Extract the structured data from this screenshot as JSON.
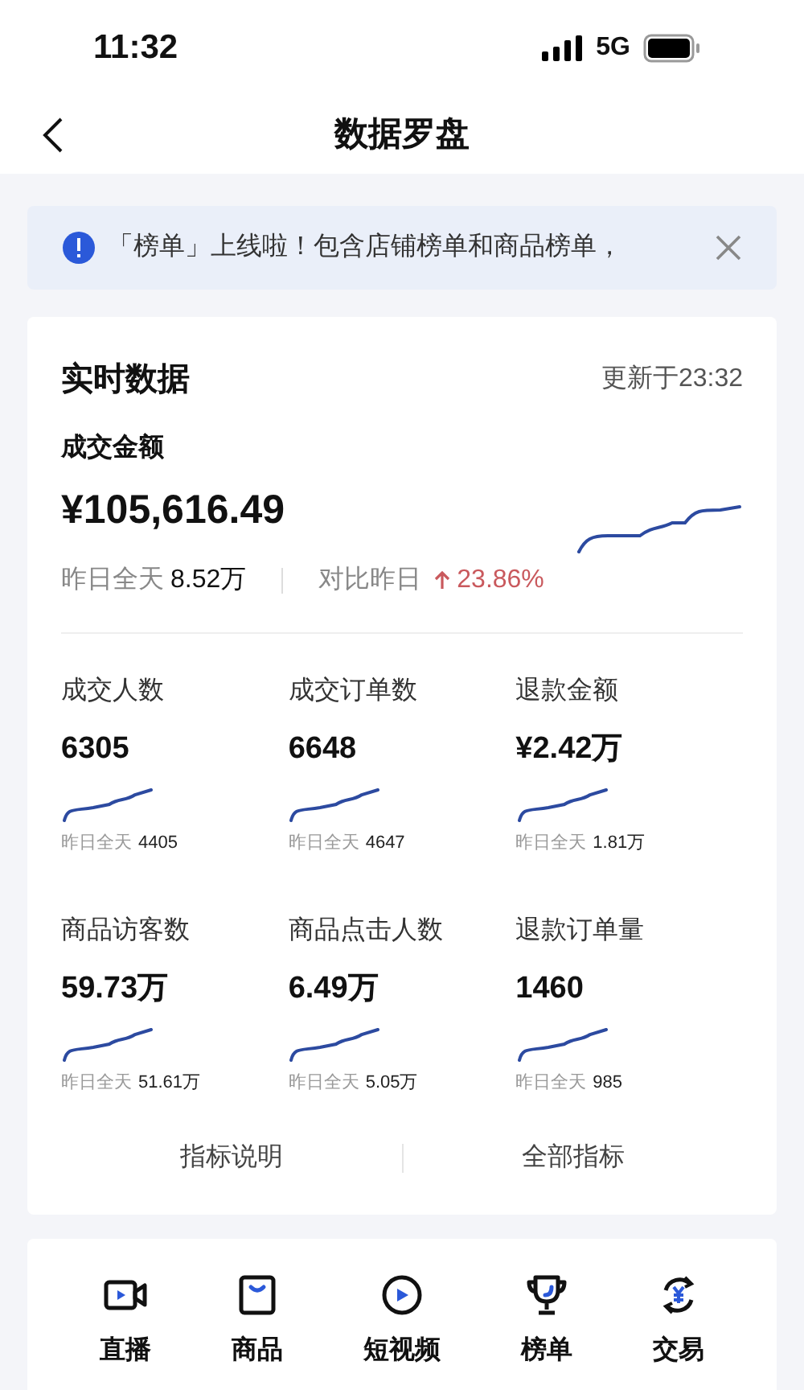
{
  "status_bar": {
    "time": "11:32",
    "network": "5G"
  },
  "header": {
    "title": "数据罗盘"
  },
  "notice": {
    "text": "「榜单」上线啦！包含店铺榜单和商品榜单，"
  },
  "realtime": {
    "title": "实时数据",
    "updated": "更新于23:32",
    "main": {
      "label": "成交金额",
      "value": "¥105,616.49",
      "yesterday_label": "昨日全天",
      "yesterday_value": "8.52万",
      "compare_label": "对比昨日",
      "change": "23.86%",
      "rising": true
    },
    "metrics": [
      {
        "label": "成交人数",
        "value": "6305",
        "yesterday_label": "昨日全天",
        "yesterday_value": "4405"
      },
      {
        "label": "成交订单数",
        "value": "6648",
        "yesterday_label": "昨日全天",
        "yesterday_value": "4647"
      },
      {
        "label": "退款金额",
        "value": "¥2.42万",
        "yesterday_label": "昨日全天",
        "yesterday_value": "1.81万"
      },
      {
        "label": "商品访客数",
        "value": "59.73万",
        "yesterday_label": "昨日全天",
        "yesterday_value": "51.61万"
      },
      {
        "label": "商品点击人数",
        "value": "6.49万",
        "yesterday_label": "昨日全天",
        "yesterday_value": "5.05万"
      },
      {
        "label": "退款订单量",
        "value": "1460",
        "yesterday_label": "昨日全天",
        "yesterday_value": "985"
      }
    ],
    "links": [
      "指标说明",
      "全部指标"
    ]
  },
  "shortcuts": [
    {
      "kind": "live",
      "label": "直播"
    },
    {
      "kind": "goods",
      "label": "商品"
    },
    {
      "kind": "video",
      "label": "短视频"
    },
    {
      "kind": "rank",
      "label": "榜单"
    },
    {
      "kind": "trade",
      "label": "交易"
    }
  ]
}
